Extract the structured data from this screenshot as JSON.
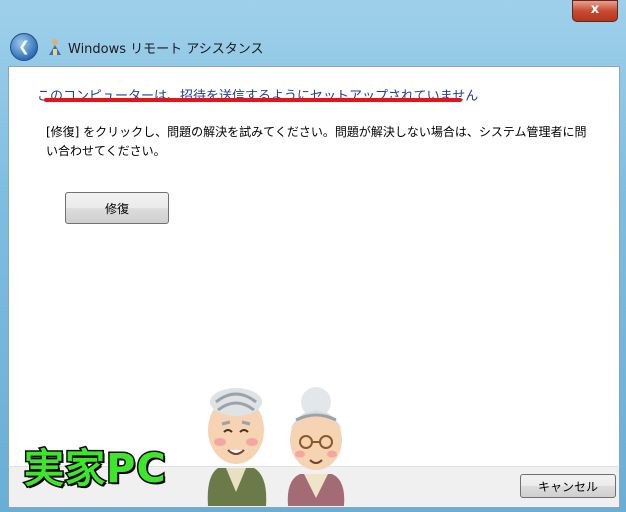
{
  "window": {
    "title": "Windows リモート アシスタンス",
    "close_label": "x"
  },
  "main": {
    "heading": "このコンピューターは、招待を送信するようにセットアップされていません",
    "description": "[修復] をクリックし、問題の解決を試みてください。問題が解決しない場合は、システム管理者に問い合わせてください。",
    "fix_button": "修復"
  },
  "footer": {
    "cancel_button": "キャンセル"
  },
  "overlay": {
    "caption": "実家PC"
  },
  "icons": [
    "back-arrow-icon",
    "remote-assistance-icon",
    "close-icon"
  ],
  "colors": {
    "heading": "#1e3f9c",
    "highlight_underline": "#e8121a",
    "caption": "#3de62a"
  }
}
